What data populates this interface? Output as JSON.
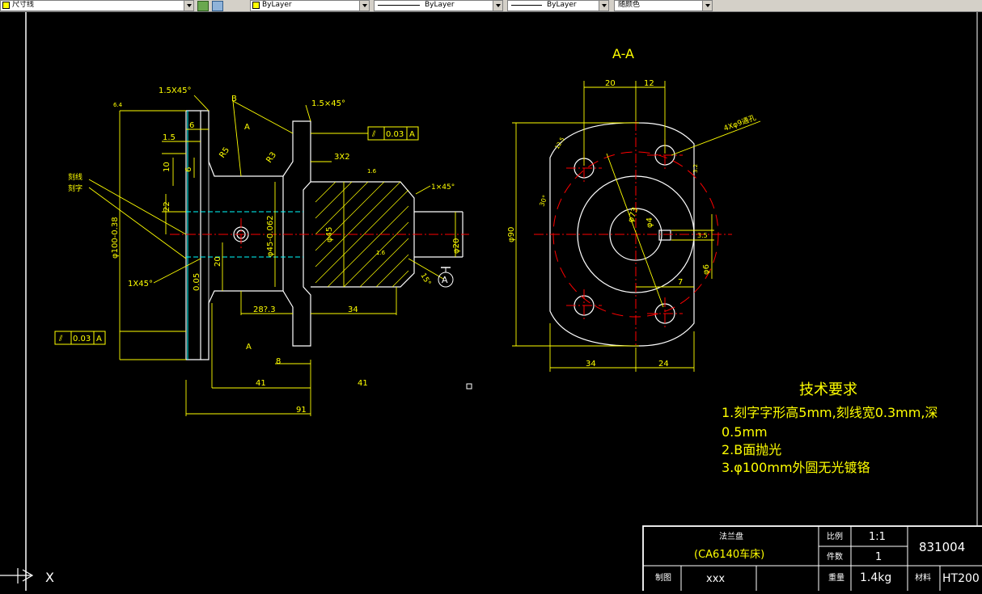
{
  "toolbar": {
    "dim_style": "尺寸线",
    "layer": "ByLayer",
    "linetype": "ByLayer",
    "lineweight": "ByLayer",
    "plot_color": "随颜色"
  },
  "colors": {
    "background": "#000000",
    "dimension": "#ffff00",
    "outline": "#ffffff",
    "centerline": "#ff0000",
    "hidden": "#00ffff"
  },
  "drawing": {
    "section_title": "A-A",
    "tech_title": "技术要求",
    "tech_lines": [
      "1.刻字字形高5mm,刻线宽0.3mm,深",
      "0.5mm",
      "2.B面抛光",
      "3.φ100mm外圆无光镀铬"
    ],
    "tol_1": "0.03",
    "tol_1_datum": "A",
    "tol_2": "0.03",
    "tol_2_datum": "A",
    "datum_a": "A",
    "labels": {
      "chamfer_15_a": "1.5X45°",
      "chamfer_15_b": "1.5×45°",
      "b_mark": "B",
      "a_top": "A",
      "a_bottom": "A",
      "chamfer_1_a": "1X45°",
      "chamfer_1_b": "1×45°",
      "grooving": "3X2",
      "engrave_line": "刻线",
      "engrave_char": "刻字",
      "r5": "R5",
      "r3": "R3",
      "d_15": "1.5",
      "d_6a": "6",
      "d_6b": "6",
      "d_10": "10",
      "d_22": "22",
      "d_100": "φ100-0.38",
      "d_20": "20",
      "d_005": "0.05",
      "d_45": "φ45-0.062",
      "d_45b": "φ45",
      "d_20b": "φ20",
      "d_287": "28?.3",
      "d_34": "34",
      "d_8": "8",
      "d_41a": "41",
      "d_41b": "41",
      "d_91": "91",
      "d_15deg": "15°",
      "s_20": "20",
      "s_12": "12",
      "s_90": "φ90",
      "s_34": "34",
      "s_24": "24",
      "s_hole": "4Xφ9通孔",
      "s_73": "φ73",
      "s_4": "φ4",
      "s_35": "3.5",
      "s_6": "φ6",
      "s_7": "7",
      "s_30": "30°",
      "r_64": "6.4",
      "r_32": "3.2",
      "r_125": "12.5",
      "r_16": "1.6"
    }
  },
  "title_block": {
    "part_name": "法兰盘",
    "machine": "(CA6140车床)",
    "scale_label": "比例",
    "scale_value": "1:1",
    "qty_label": "件数",
    "qty_value": "1",
    "drawing_no": "831004",
    "drawn_label": "制图",
    "drawn_value": "xxx",
    "weight_label": "重量",
    "weight_value": "1.4kg",
    "material_label": "材料",
    "material_value": "HT200"
  },
  "ucs": {
    "x_label": "X"
  }
}
